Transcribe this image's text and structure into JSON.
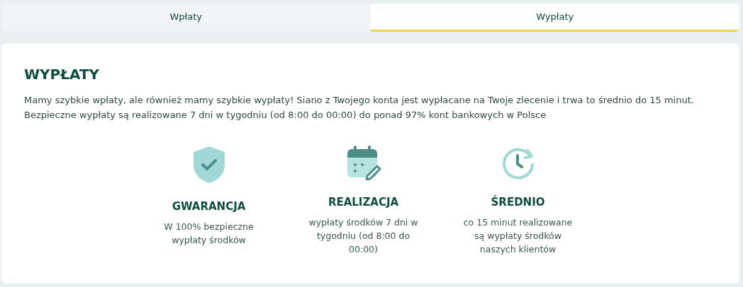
{
  "tabs": [
    {
      "label": "Wpłaty",
      "selected": false
    },
    {
      "label": "Wypłaty",
      "selected": true
    }
  ],
  "section": {
    "title": "WYPŁATY",
    "text": "Mamy szybkie wpłaty, ale również mamy szybkie wypłaty! Siano z Twojego konta jest wypłacane na Twoje zlecenie i trwa to średnio do 15 minut. Bezpieczne wypłaty są realizowane 7 dni w tygodniu (od 8:00 do 00:00) do ponad 97% kont bankowych w Polsce"
  },
  "features": [
    {
      "kind": "shield",
      "title": "GWARANCJA",
      "text": "W 100% bezpieczne wypłaty środków"
    },
    {
      "kind": "calendar",
      "title": "REALIZACJA",
      "text": "wypłaty środków 7 dni w tygodniu (od 8:00 do 00:00)"
    },
    {
      "kind": "clock",
      "title": "ŚREDNIO",
      "text": "co 15 minut realizowane są wypłaty środków naszych klientów"
    }
  ]
}
